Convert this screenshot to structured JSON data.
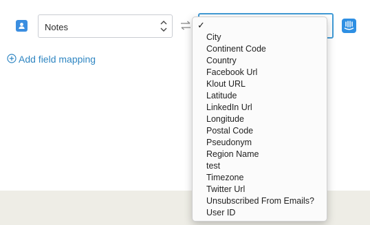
{
  "mapping_row": {
    "source_field": {
      "value": "Notes",
      "icon": "contact-card-icon"
    },
    "swap_icon": "swap-arrows-icon",
    "destination_icon": "intercom-icon"
  },
  "add_field_mapping": {
    "icon": "plus-circle-icon",
    "label": "Add field mapping"
  },
  "dropdown": {
    "selected_mark": "✓",
    "options": [
      "City",
      "Continent Code",
      "Country",
      "Facebook Url",
      "Klout URL",
      "Latitude",
      "LinkedIn Url",
      "Longitude",
      "Postal Code",
      "Pseudonym",
      "Region Name",
      "test",
      "Timezone",
      "Twitter Url",
      "Unsubscribed From Emails?",
      "User ID"
    ]
  },
  "colors": {
    "accent": "#2f86c2",
    "icon_blue": "#3b8ee0",
    "focus_border": "#3f9ad6",
    "footer_band": "#eeede6"
  }
}
